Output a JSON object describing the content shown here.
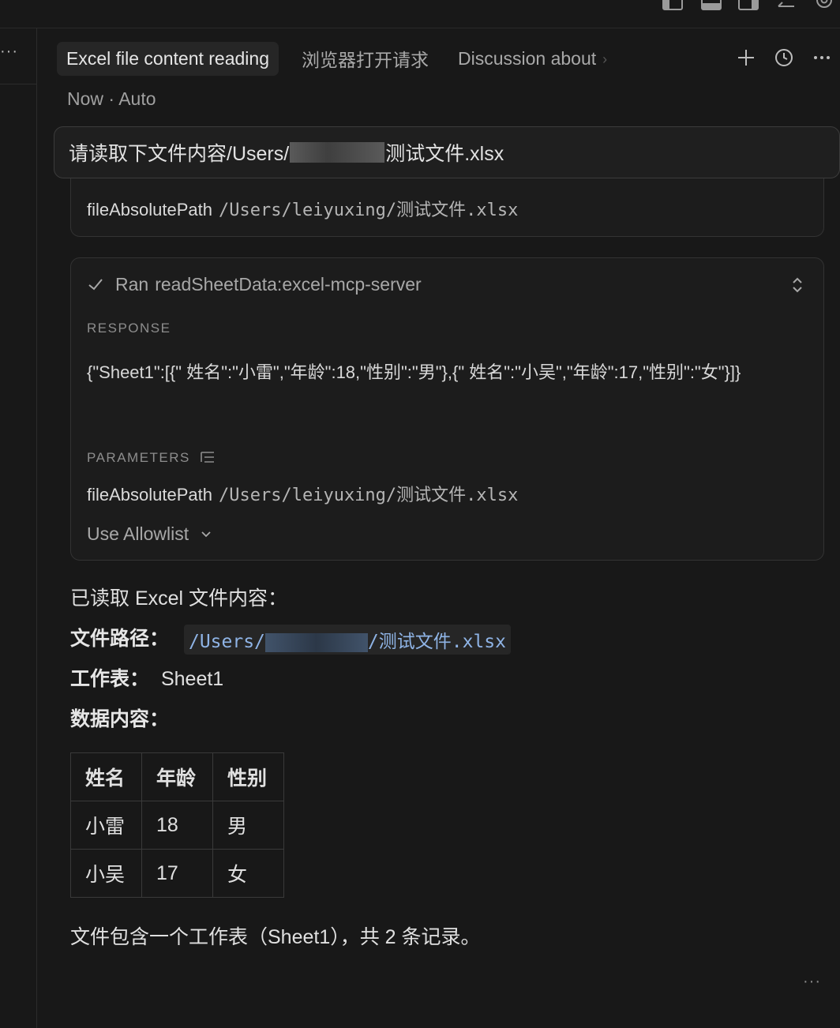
{
  "header": {
    "tabs": [
      {
        "label": "Excel file content reading",
        "active": true
      },
      {
        "label": "浏览器打开请求",
        "active": false
      },
      {
        "label": "Discussion about",
        "active": false
      }
    ],
    "actions": [
      "plus-icon",
      "history-icon",
      "more-icon"
    ]
  },
  "meta": {
    "time": "Now",
    "separator": "·",
    "mode": "Auto"
  },
  "prompt": {
    "prefix": "请读取下文件内容/Users/",
    "suffix": "测试文件.xlsx"
  },
  "tool_call_top": {
    "param_name": "fileAbsolutePath",
    "param_value": "/Users/leiyuxing/测试文件.xlsx"
  },
  "tool_call": {
    "status_label": "Ran",
    "tool_name": "readSheetData:excel-mcp-server",
    "response_label": "RESPONSE",
    "response_text": "{\"Sheet1\":[{\" 姓名\":\"小雷\",\"年龄\":18,\"性别\":\"男\"},{\" 姓名\":\"小吴\",\"年龄\":17,\"性别\":\"女\"}]}",
    "parameters_label": "PARAMETERS",
    "param_name": "fileAbsolutePath",
    "param_value": "/Users/leiyuxing/测试文件.xlsx",
    "allowlist_label": "Use Allowlist"
  },
  "answer": {
    "intro": "已读取 Excel 文件内容：",
    "path_label": "文件路径：",
    "path_prefix": "/Users/",
    "path_suffix": "/测试文件.xlsx",
    "sheet_label": "工作表：",
    "sheet_value": "Sheet1",
    "data_label": "数据内容：",
    "table": {
      "headers": [
        "姓名",
        "年龄",
        "性别"
      ],
      "rows": [
        [
          "小雷",
          "18",
          "男"
        ],
        [
          "小吴",
          "17",
          "女"
        ]
      ]
    },
    "summary": "文件包含一个工作表（Sheet1），共 2 条记录。"
  },
  "colors": {
    "background": "#181818",
    "card": "#1c1c1c",
    "border": "#333333",
    "code_text": "#8fb4e6"
  }
}
